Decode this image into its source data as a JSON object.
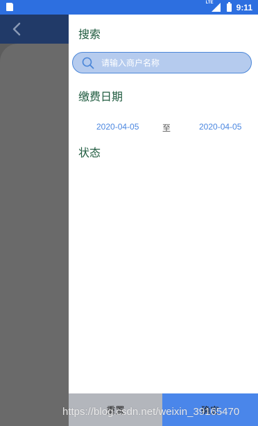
{
  "status_bar": {
    "network": "LTE",
    "time": "9:11"
  },
  "background_page": {
    "back_icon": "chevron-left-icon"
  },
  "drawer": {
    "search": {
      "title": "搜索",
      "placeholder": "请输入商户名称",
      "value": "",
      "icon": "search-icon"
    },
    "payment_date": {
      "title": "缴费日期",
      "start": "2020-04-05",
      "separator": "至",
      "end": "2020-04-05"
    },
    "status": {
      "title": "状态"
    },
    "footer": {
      "reset_label": "重置",
      "confirm_label": "确定"
    }
  },
  "watermark": "https://blog.csdn.net/weixin_39165470",
  "colors": {
    "status_bar": "#2d6fe0",
    "accent": "#4a86e0",
    "section_title": "#1f5b3f",
    "reset_button": "#b3b6bc",
    "confirm_button": "#4a86ea",
    "overlay": "#5c5c5c"
  }
}
